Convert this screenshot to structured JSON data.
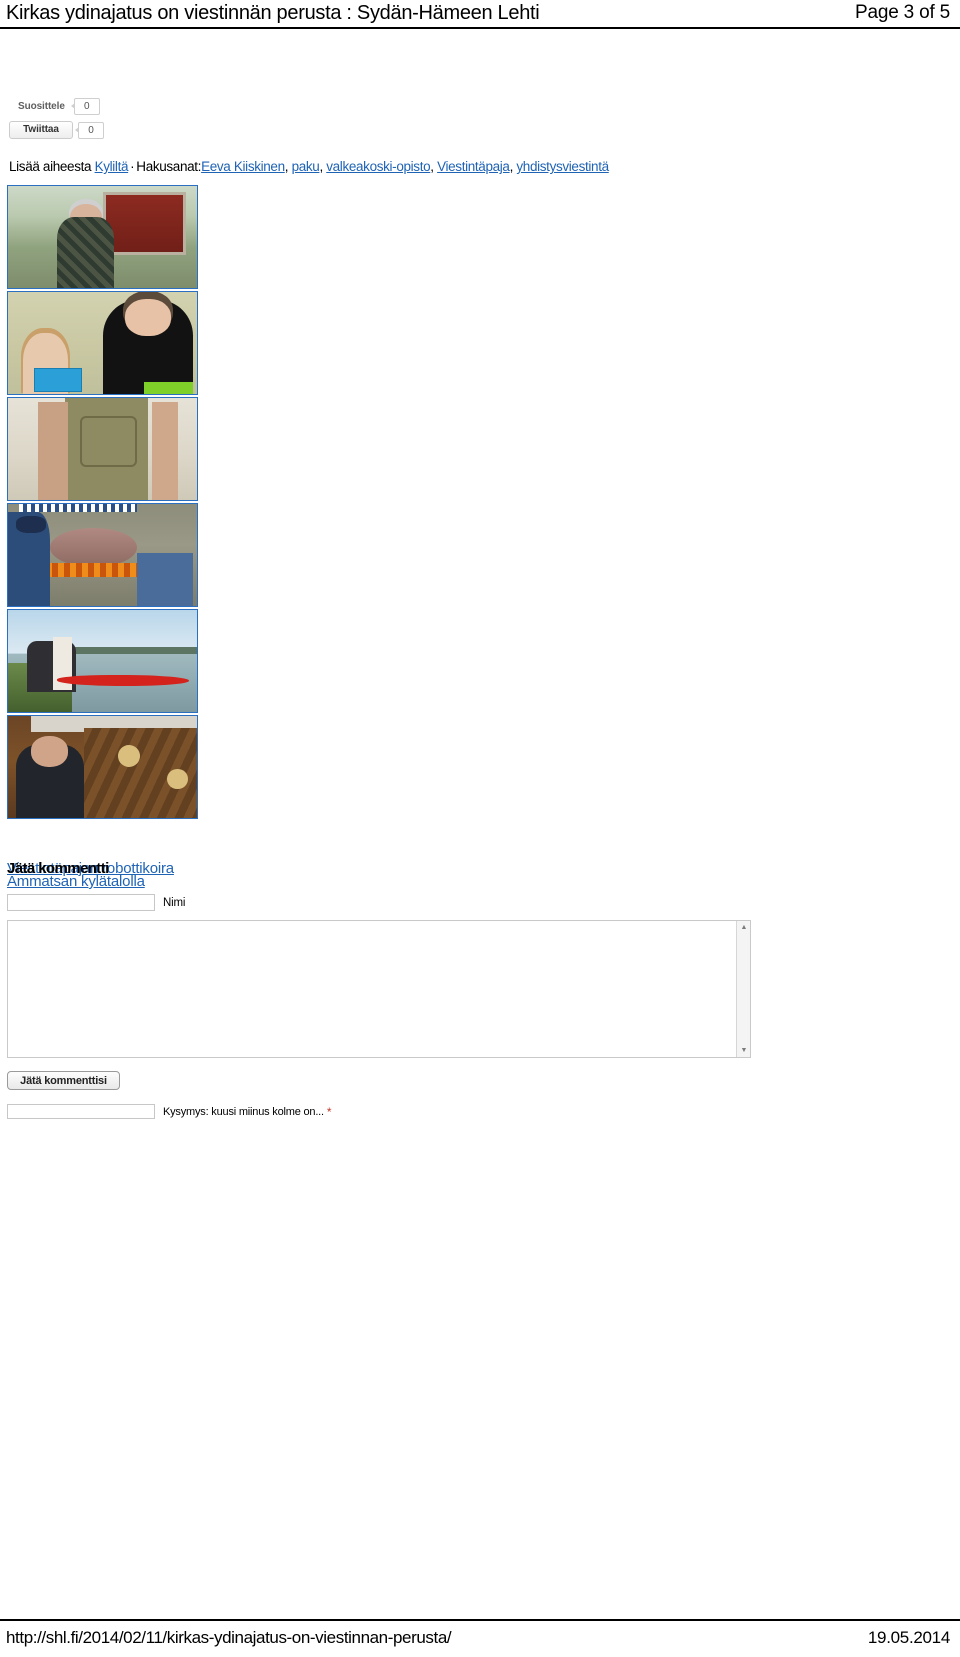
{
  "header": {
    "title": "Kirkas ydinajatus on viestinnän perusta : Sydän-Hämeen Lehti",
    "page_indicator": "Page 3 of 5"
  },
  "social": {
    "facebook": {
      "label": "Suosittele",
      "count": "0"
    },
    "twitter": {
      "label": "Twiittaa",
      "count": "0"
    }
  },
  "tags": {
    "prefix": "Lisää aiheesta",
    "category": "Kyliltä",
    "separator": "·",
    "keywords_label": "Hakusanat:",
    "keywords": [
      {
        "label": "Eeva Kiiskinen",
        "trail": ","
      },
      {
        "label": "paku",
        "trail": ","
      },
      {
        "label": "valkeakoski-opisto",
        "trail": ","
      },
      {
        "label": "Viestintäpaja",
        "trail": ","
      },
      {
        "label": "yhdistysviestintä",
        "trail": ""
      }
    ]
  },
  "thumbnails": [
    {
      "alt": "Mies punaisen aitan edessä"
    },
    {
      "alt": "Lapsi ja nainen askartelemassa"
    },
    {
      "alt": "Henkilö essussa keramiikkapajassa"
    },
    {
      "alt": "Possun paistaminen nuotiolla"
    },
    {
      "alt": "Punainen kajakki järvellä"
    },
    {
      "alt": "Mies antiikkihuonekalujen äärellä"
    }
  ],
  "related_links": {
    "line1": "Viestintäpajan robottikoira",
    "line2": "Ammatsan kylätalolla"
  },
  "comment_form": {
    "heading": "Jätä kommentti",
    "name_label": "Nimi",
    "name_value": "",
    "comment_value": "",
    "submit_label": "Jätä kommenttisi",
    "captcha_value": "",
    "captcha_label": "Kysymys: kuusi miinus kolme on...",
    "required_mark": "*",
    "scroll_up_icon": "▲",
    "scroll_down_icon": "▼"
  },
  "footer": {
    "url": "http://shl.fi/2014/02/11/kirkas-ydinajatus-on-viestinnan-perusta/",
    "date": "19.05.2014"
  },
  "colors": {
    "link": "#1f63b5",
    "thumb_border": "#2a6fc0",
    "rule": "#000000"
  }
}
